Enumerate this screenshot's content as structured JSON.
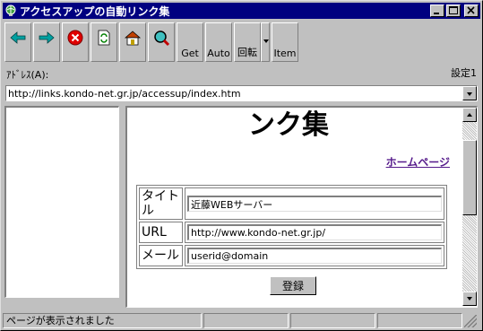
{
  "window": {
    "title": "アクセスアップの自動リンク集",
    "icon": "globe-icon"
  },
  "toolbar": {
    "buttons": [
      {
        "name": "back",
        "icon": "arrow-left-icon",
        "color": "#00a0a0"
      },
      {
        "name": "forward",
        "icon": "arrow-right-icon",
        "color": "#00a0a0"
      },
      {
        "name": "stop",
        "icon": "stop-icon",
        "color": "#e00000"
      },
      {
        "name": "refresh",
        "icon": "refresh-icon",
        "color": "#008000"
      },
      {
        "name": "home",
        "icon": "home-icon",
        "color": "#c0a000"
      },
      {
        "name": "search",
        "icon": "search-icon",
        "color": "#008080"
      }
    ],
    "get_label": "Get",
    "auto_label": "Auto",
    "rotate_label": "回転",
    "item_label": "Item"
  },
  "address": {
    "label": "ｱﾄﾞﾚｽ(A):",
    "url": "http://links.kondo-net.gr.jp/accessup/index.htm"
  },
  "settings": {
    "label": "設定1"
  },
  "page": {
    "heading": "ンク集",
    "home_link": "ホームページ",
    "form": {
      "title_label": "タイトル",
      "title_value": "近藤WEBサーバー",
      "url_label": "URL",
      "url_value": "http://www.kondo-net.gr.jp/",
      "mail_label": "メール",
      "mail_value": "userid@domain",
      "submit_label": "登録"
    }
  },
  "status": {
    "text": "ページが表示されました",
    "cell2": "",
    "cell3": "",
    "cell4": ""
  },
  "colors": {
    "titlebar": "#000080",
    "face": "#c0c0c0",
    "link": "#551a8b"
  }
}
